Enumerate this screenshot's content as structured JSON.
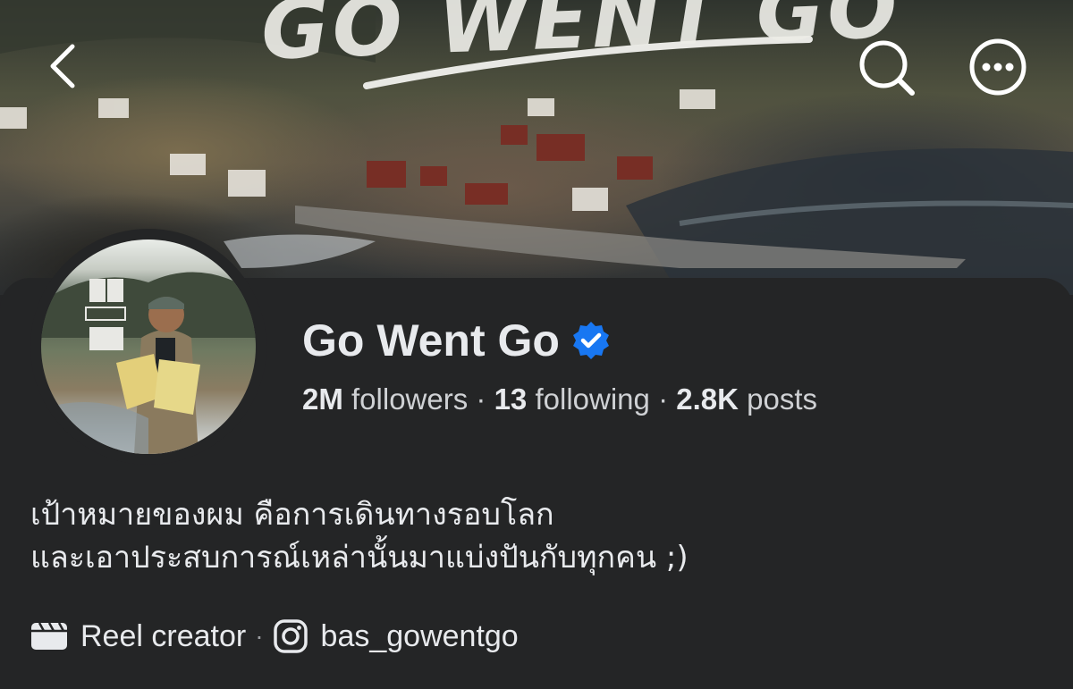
{
  "cover": {
    "title_art": "GO WENT GO"
  },
  "topbar": {
    "back_icon": "chevron-left-icon",
    "search_icon": "search-icon",
    "more_icon": "more-horizontal-icon"
  },
  "profile": {
    "name": "Go Went Go",
    "verified": true,
    "accent": "#1877f2",
    "followers_count": "2M",
    "followers_label": "followers",
    "following_count": "13",
    "following_label": "following",
    "posts_count": "2.8K",
    "posts_label": "posts",
    "bio_line1": "เป้าหมายของผม คือการเดินทางรอบโลก",
    "bio_line2": "และเอาประสบการณ์เหล่านั้นมาแบ่งปันกับทุกคน ;)",
    "category": "Reel creator",
    "instagram": "bas_gowentgo"
  }
}
